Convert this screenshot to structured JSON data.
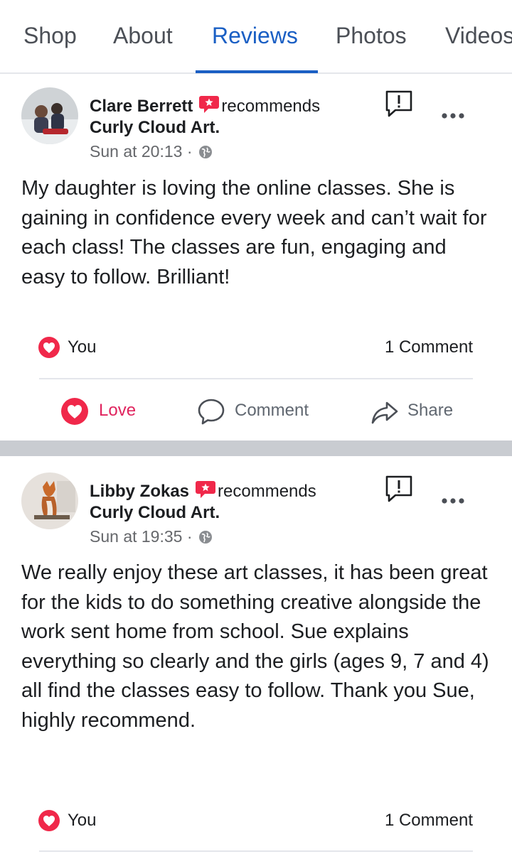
{
  "tabs": [
    {
      "label": "Shop"
    },
    {
      "label": "About"
    },
    {
      "label": "Reviews",
      "active": true
    },
    {
      "label": "Photos"
    },
    {
      "label": "Videos"
    }
  ],
  "colors": {
    "accent": "#1a5fc4",
    "love": "#e0245e",
    "badge": "#f0284a",
    "separator": "#c9ccd1"
  },
  "reviews": [
    {
      "author": "Clare Berrett",
      "recommends": "recommends",
      "page": "Curly Cloud Art.",
      "time": "Sun at 20:13 ·",
      "text": "My daughter is loving the online classes. She is gaining in confidence every week and can’t wait for each class! The classes are fun, engaging and easy to follow. Brilliant!",
      "reaction": "You",
      "comments": "1 Comment",
      "actions": {
        "love": "Love",
        "comment": "Comment",
        "share": "Share"
      }
    },
    {
      "author": "Libby Zokas",
      "recommends": "recommends",
      "page": "Curly Cloud Art.",
      "time": "Sun at 19:35 ·",
      "text": "We really enjoy these art classes, it has been great for the kids to do something creative alongside the work sent home from school. Sue explains everything so clearly and the girls (ages 9, 7 and 4) all find the classes easy to follow. Thank you Sue, highly recommend.",
      "reaction": "You",
      "comments": "1 Comment"
    }
  ]
}
